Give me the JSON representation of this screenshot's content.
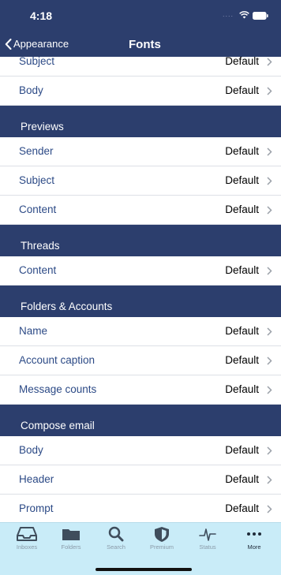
{
  "status_bar": {
    "time": "4:18",
    "signal": "....",
    "wifi_icon": "wifi-icon",
    "battery_icon": "battery-icon"
  },
  "nav": {
    "back_label": "Appearance",
    "title": "Fonts"
  },
  "top_rows": [
    {
      "label": "Subject",
      "value": "Default"
    },
    {
      "label": "Body",
      "value": "Default"
    }
  ],
  "sections": [
    {
      "title": "Previews",
      "rows": [
        {
          "label": "Sender",
          "value": "Default"
        },
        {
          "label": "Subject",
          "value": "Default"
        },
        {
          "label": "Content",
          "value": "Default"
        }
      ]
    },
    {
      "title": "Threads",
      "rows": [
        {
          "label": "Content",
          "value": "Default"
        }
      ]
    },
    {
      "title": "Folders & Accounts",
      "rows": [
        {
          "label": "Name",
          "value": "Default"
        },
        {
          "label": "Account caption",
          "value": "Default"
        },
        {
          "label": "Message counts",
          "value": "Default"
        }
      ]
    },
    {
      "title": "Compose email",
      "rows": [
        {
          "label": "Body",
          "value": "Default"
        },
        {
          "label": "Header",
          "value": "Default"
        },
        {
          "label": "Prompt",
          "value": "Default"
        }
      ]
    }
  ],
  "tabs": [
    {
      "label": "Inboxes",
      "icon": "inbox-tray-icon"
    },
    {
      "label": "Folders",
      "icon": "folder-icon"
    },
    {
      "label": "Search",
      "icon": "magnifier-icon"
    },
    {
      "label": "Premium",
      "icon": "shield-icon"
    },
    {
      "label": "Status",
      "icon": "pulse-icon"
    },
    {
      "label": "More",
      "icon": "ellipsis-icon"
    }
  ],
  "colors": {
    "header_navy": "#2c3e6d",
    "row_label_blue": "#2c4a86",
    "tab_bar_bg": "#c9ecf8"
  }
}
